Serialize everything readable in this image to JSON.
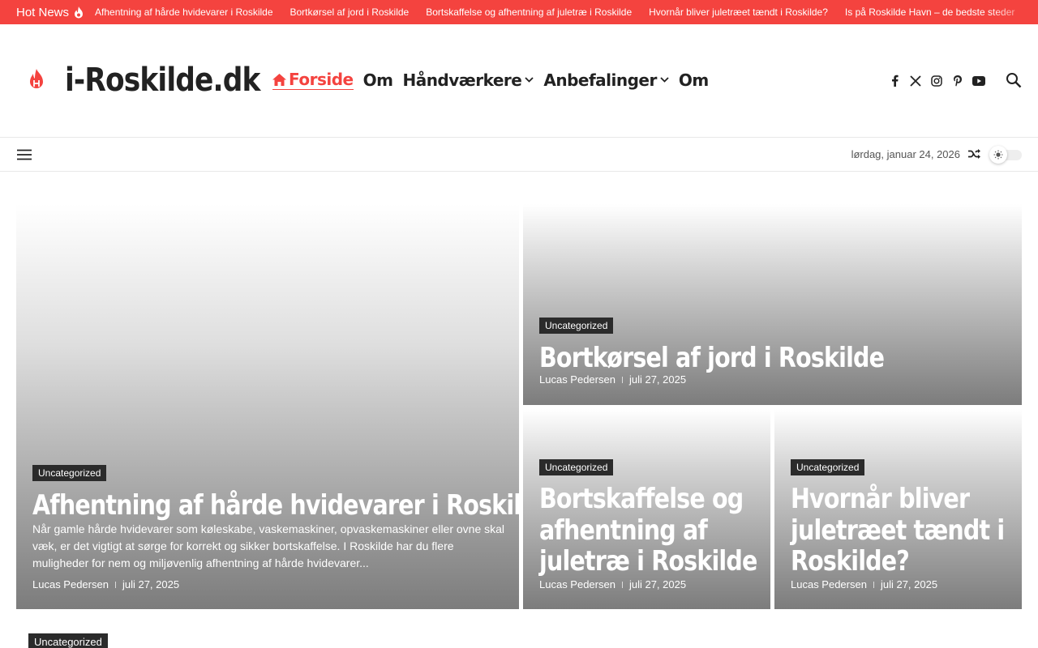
{
  "hotnews": {
    "label": "Hot News",
    "items": [
      "Afhentning af hårde hvidevarer i Roskilde",
      "Bortkørsel af jord i Roskilde",
      "Bortskaffelse og afhentning af juletræ i Roskilde",
      "Hvornår bliver juletræet tændt i Roskilde?",
      "Is på Roskilde Havn – de bedste steder"
    ]
  },
  "header": {
    "site_title": "i-Roskilde.dk",
    "nav": [
      {
        "label": "Forside",
        "active": true
      },
      {
        "label": "Om"
      },
      {
        "label": "Håndværkere",
        "dropdown": true
      },
      {
        "label": "Anbefalinger",
        "dropdown": true
      },
      {
        "label": "Om"
      }
    ],
    "socials": [
      "facebook-icon",
      "x-twitter-icon",
      "instagram-icon",
      "pinterest-icon",
      "youtube-icon"
    ]
  },
  "subbar": {
    "date": "lørdag, januar 24, 2026"
  },
  "colors": {
    "accent": "#f4433f",
    "category_bg": "#2b2b2b"
  },
  "cards": [
    {
      "category": "Uncategorized",
      "title": "Afhentning af hårde hvidevarer i Roskilde",
      "excerpt": "Når gamle hårde hvidevarer som køleskabe, vaskemaskiner, opvaskemaskiner eller ovne skal væk, er det vigtigt at sørge for korrekt og sikker bortskaffelse. I Roskilde har du flere muligheder for nem og miljøvenlig afhentning af hårde hvidevarer...",
      "author": "Lucas Pedersen",
      "date": "juli 27, 2025"
    },
    {
      "category": "Uncategorized",
      "title": "Bortkørsel af jord i Roskilde",
      "author": "Lucas Pedersen",
      "date": "juli 27, 2025"
    },
    {
      "category": "Uncategorized",
      "title_lines": [
        "Bortskaffelse og",
        "afhentning af",
        "juletræ i Roskilde"
      ],
      "author": "Lucas Pedersen",
      "date": "juli 27, 2025"
    },
    {
      "category": "Uncategorized",
      "title_lines": [
        "Hvornår bliver",
        "juletræet tændt i",
        "Roskilde?"
      ],
      "author": "Lucas Pedersen",
      "date": "juli 27, 2025"
    }
  ],
  "next_section": {
    "category": "Uncategorized"
  }
}
